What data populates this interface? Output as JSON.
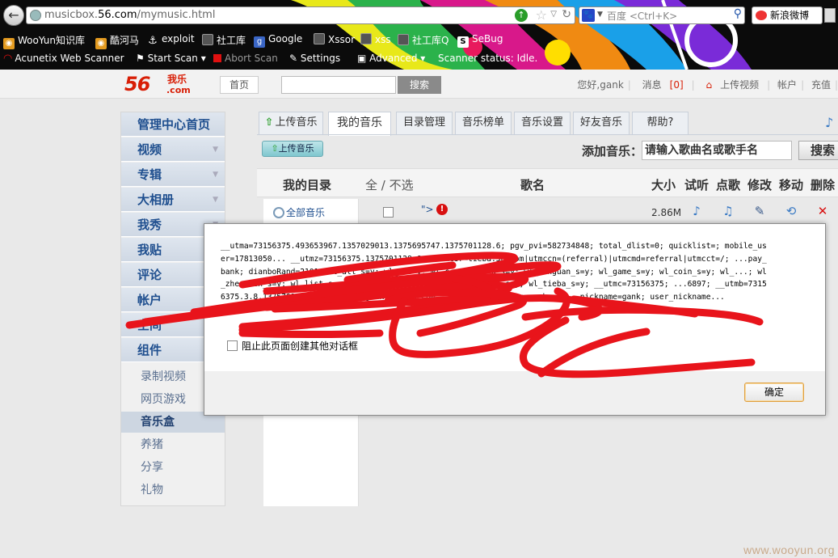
{
  "browser": {
    "url_prefix": "musicbox.",
    "url_domain": "56.com",
    "url_path": "/mymusic.html",
    "search_placeholder": "百度 <Ctrl+K>",
    "weibo_label": "新浪微博",
    "bookmarks": [
      {
        "label": "WooYun知识库",
        "icon": "rss-icon"
      },
      {
        "label": "酷河马",
        "icon": "rss-icon"
      },
      {
        "label": "exploit",
        "icon": "anchor-icon"
      },
      {
        "label": "社工库",
        "icon": "grid-icon"
      },
      {
        "label": "Google",
        "icon": "google-icon"
      },
      {
        "label": "Xssor",
        "icon": "grid-icon"
      },
      {
        "label": "xss",
        "icon": "grid-icon"
      },
      {
        "label": "社工库Q",
        "icon": "grid-icon"
      },
      {
        "label": "SeBug",
        "icon": "sebug-icon"
      }
    ],
    "acunetix": {
      "title": "Acunetix Web Scanner",
      "start_scan": "Start Scan",
      "abort_scan": "Abort Scan",
      "settings": "Settings",
      "advanced": "Advanced",
      "status": "Scanner status: Idle."
    }
  },
  "site": {
    "logo_num": "56",
    "logo_sub": "我乐",
    "logo_domain": ".com",
    "home": "首页",
    "search_button": "搜索",
    "greeting": "您好,gank",
    "messages_label": "消息",
    "messages_count": "[0]",
    "upload_video": "上传视频",
    "account": "帐户",
    "recharge": "充值"
  },
  "sidebar": {
    "items": [
      "管理中心首页",
      "视频",
      "专辑",
      "大相册",
      "我秀",
      "我贴",
      "评论",
      "帐户",
      "空间",
      "组件"
    ],
    "subitems": [
      "录制视频",
      "网页游戏",
      "音乐盒",
      "养猪",
      "分享",
      "礼物"
    ],
    "active": "音乐盒"
  },
  "main": {
    "tabs": [
      "上传音乐",
      "我的音乐",
      "目录管理",
      "音乐榜单",
      "音乐设置",
      "好友音乐",
      "帮助?"
    ],
    "upload_button": "上传音乐",
    "add_music_label": "添加音乐：",
    "add_music_value": "请输入歌曲名或歌手名",
    "add_music_search": "搜索",
    "headers": {
      "catalog": "我的目录",
      "select_all": "全 / 不选",
      "song_name": "歌名",
      "size": "大小",
      "listen": "试听",
      "request": "点歌",
      "edit": "修改",
      "move": "移动",
      "delete": "删除"
    },
    "catalog_all": "全部音乐",
    "row_name": "\">",
    "row_size": "2.86M"
  },
  "dialog": {
    "message": "__utma=73156375.493653967.1357029013.1375695747.1375701128.6; pgv_pvi=582734848; total_dlist=0; quicklist=; mobile_user=17813050... __utmz=73156375.1375701128.6.3.utmcsr=tieba.56.com|utmccn=(referral)|utmcmd=referral|utmcct=/; ...pay_bank; dianboRand=2101; wl_all_s=y; wl_a_s=y; wl_c_s=y; wl_g_s=y; wl_banguan_s=y; wl_game_s=y; wl_coin_s=y; wl_...; wl_zhenshen_s=y; wl_list_s=y; wl_kantai_s=y; wl_tt_s=y; wl_bbs_s=y; wl_tieba_s=y; __utmc=73156375; ...6897; __utmb=73156375.3.8.1375701128; member_id=gankfuck@56.com; ...ddd6570e045d2e... host... nickname=gank; user_nickname...",
    "suppress_label": "阻止此页面创建其他对话框",
    "ok_label": "确定"
  },
  "watermark": "www.wooyun.org",
  "colors": {
    "scribble": "#e8141b",
    "link": "#1f4f8f",
    "brand": "#d81e06"
  }
}
